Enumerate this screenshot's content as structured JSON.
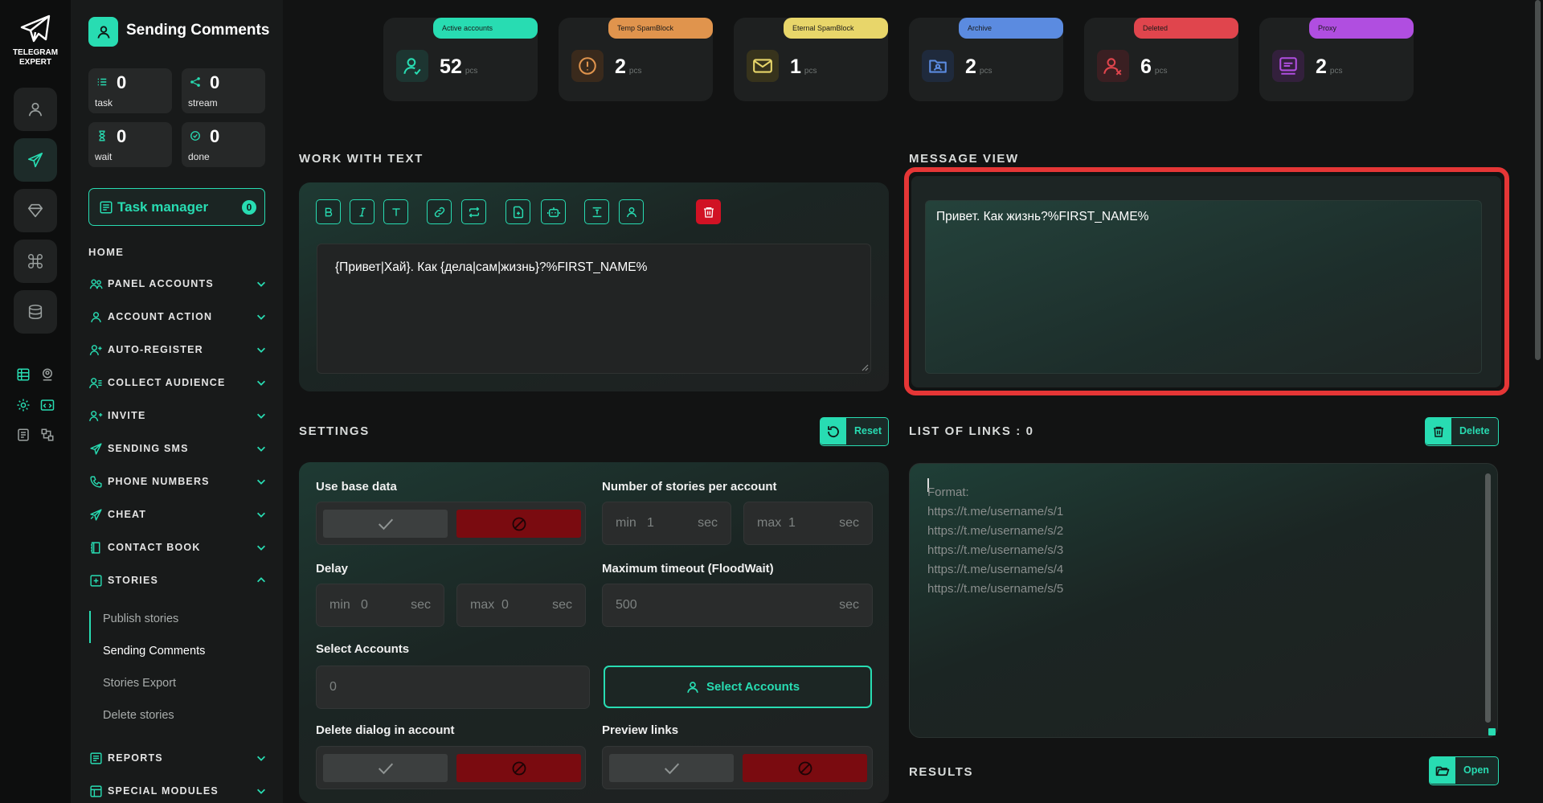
{
  "app": {
    "logo_line1": "TELEGRAM",
    "logo_line2": "EXPERT",
    "page_title": "Sending Comments",
    "accent": "#28dcb2"
  },
  "stats": {
    "task": {
      "value": "0",
      "label": "task"
    },
    "stream": {
      "value": "0",
      "label": "stream"
    },
    "wait": {
      "value": "0",
      "label": "wait"
    },
    "done": {
      "value": "0",
      "label": "done"
    }
  },
  "task_manager": {
    "label": "Task manager",
    "count": "0"
  },
  "nav": {
    "home": "HOME",
    "items": [
      {
        "label": "PANEL ACCOUNTS",
        "icon": "users-icon"
      },
      {
        "label": "ACCOUNT ACTION",
        "icon": "user-icon"
      },
      {
        "label": "AUTO-REGISTER",
        "icon": "user-plus-icon"
      },
      {
        "label": "COLLECT AUDIENCE",
        "icon": "audience-icon"
      },
      {
        "label": "INVITE",
        "icon": "invite-icon"
      },
      {
        "label": "SENDING SMS",
        "icon": "send-icon"
      },
      {
        "label": "PHONE NUMBERS",
        "icon": "phone-icon"
      },
      {
        "label": "CHEAT",
        "icon": "cheat-icon"
      },
      {
        "label": "CONTACT BOOK",
        "icon": "book-icon"
      },
      {
        "label": "STORIES",
        "icon": "plus-square-icon"
      },
      {
        "label": "REPORTS",
        "icon": "report-icon"
      },
      {
        "label": "SPECIAL MODULES",
        "icon": "modules-icon"
      }
    ],
    "stories_sub": [
      "Publish stories",
      "Sending Comments",
      "Stories Export",
      "Delete stories"
    ]
  },
  "accounts": [
    {
      "pill": "Active accounts",
      "value": "52",
      "unit": "pcs",
      "color": "#28dcb2"
    },
    {
      "pill": "Temp SpamBlock",
      "value": "2",
      "unit": "pcs",
      "color": "#e0944d"
    },
    {
      "pill": "Eternal SpamBlock",
      "value": "1",
      "unit": "pcs",
      "color": "#e8d66a"
    },
    {
      "pill": "Archive",
      "value": "2",
      "unit": "pcs",
      "color": "#5b8be0"
    },
    {
      "pill": "Deleted",
      "value": "6",
      "unit": "pcs",
      "color": "#e0454d"
    },
    {
      "pill": "Proxy",
      "value": "2",
      "unit": "pcs",
      "color": "#b04ee0"
    }
  ],
  "work_with_text": {
    "title": "WORK WITH TEXT",
    "text": "{Привет|Хай}. Как {дела|сам|жизнь}?%FIRST_NAME%"
  },
  "message_view": {
    "title": "MESSAGE VIEW",
    "text": "Привет. Как жизнь?%FIRST_NAME%"
  },
  "settings": {
    "title": "SETTINGS",
    "reset": "Reset",
    "use_base_data": "Use base data",
    "stories_per_account": "Number of stories per account",
    "stories_min": {
      "prefix": "min",
      "value": "1",
      "unit": "sec"
    },
    "stories_max": {
      "prefix": "max",
      "value": "1",
      "unit": "sec"
    },
    "delay": "Delay",
    "delay_min": {
      "prefix": "min",
      "value": "0",
      "unit": "sec"
    },
    "delay_max": {
      "prefix": "max",
      "value": "0",
      "unit": "sec"
    },
    "max_timeout": "Maximum timeout (FloodWait)",
    "timeout_value": "500",
    "timeout_unit": "sec",
    "select_accounts": "Select Accounts",
    "select_accounts_value": "0",
    "select_accounts_button": "Select Accounts",
    "delete_dialog": "Delete dialog in account",
    "preview_links": "Preview links"
  },
  "links": {
    "title": "LIST OF LINKS : 0",
    "delete": "Delete",
    "placeholder": "Format:\nhttps://t.me/username/s/1\nhttps://t.me/username/s/2\nhttps://t.me/username/s/3\nhttps://t.me/username/s/4\nhttps://t.me/username/s/5"
  },
  "results": {
    "title": "RESULTS",
    "open": "Open"
  }
}
